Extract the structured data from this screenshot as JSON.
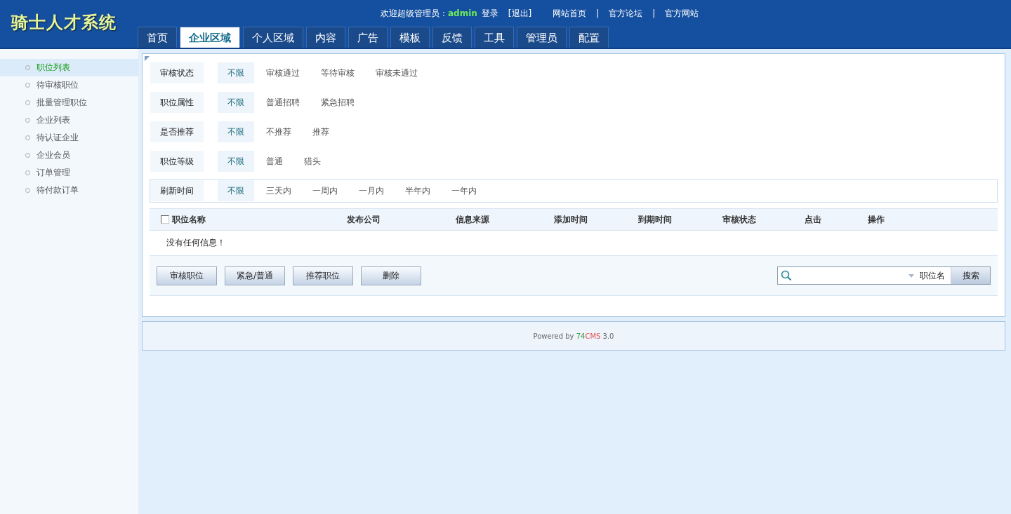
{
  "logo": "骑士人才系统",
  "top_bar": {
    "welcome": "欢迎超级管理员：",
    "user": "admin",
    "login": "登录",
    "logout": "[退出]",
    "links": [
      "网站首页",
      "官方论坛",
      "官方网站"
    ],
    "separator": "|"
  },
  "nav_tabs": [
    {
      "label": "首页",
      "selected": false
    },
    {
      "label": "企业区域",
      "selected": true
    },
    {
      "label": "个人区域",
      "selected": false
    },
    {
      "label": "内容",
      "selected": false
    },
    {
      "label": "广告",
      "selected": false
    },
    {
      "label": "模板",
      "selected": false
    },
    {
      "label": "反馈",
      "selected": false
    },
    {
      "label": "工具",
      "selected": false
    },
    {
      "label": "管理员",
      "selected": false
    },
    {
      "label": "配置",
      "selected": false
    }
  ],
  "sidebar": {
    "items": [
      {
        "label": "职位列表",
        "selected": true
      },
      {
        "label": "待审核职位",
        "selected": false
      },
      {
        "label": "批量管理职位",
        "selected": false
      },
      {
        "label": "企业列表",
        "selected": false
      },
      {
        "label": "待认证企业",
        "selected": false
      },
      {
        "label": "企业会员",
        "selected": false
      },
      {
        "label": "订单管理",
        "selected": false
      },
      {
        "label": "待付款订单",
        "selected": false
      }
    ]
  },
  "filters": [
    {
      "label": "审核状态",
      "highlighted": false,
      "options": [
        {
          "label": "不限",
          "selected": true
        },
        {
          "label": "审核通过",
          "selected": false
        },
        {
          "label": "等待审核",
          "selected": false
        },
        {
          "label": "审核未通过",
          "selected": false
        }
      ]
    },
    {
      "label": "职位属性",
      "highlighted": false,
      "options": [
        {
          "label": "不限",
          "selected": true
        },
        {
          "label": "普通招聘",
          "selected": false
        },
        {
          "label": "紧急招聘",
          "selected": false
        }
      ]
    },
    {
      "label": "是否推荐",
      "highlighted": false,
      "options": [
        {
          "label": "不限",
          "selected": true
        },
        {
          "label": "不推荐",
          "selected": false
        },
        {
          "label": "推荐",
          "selected": false
        }
      ]
    },
    {
      "label": "职位等级",
      "highlighted": false,
      "options": [
        {
          "label": "不限",
          "selected": true
        },
        {
          "label": "普通",
          "selected": false
        },
        {
          "label": "猎头",
          "selected": false
        }
      ]
    },
    {
      "label": "刷新时间",
      "highlighted": true,
      "options": [
        {
          "label": "不限",
          "selected": true
        },
        {
          "label": "三天内",
          "selected": false
        },
        {
          "label": "一周内",
          "selected": false
        },
        {
          "label": "一月内",
          "selected": false
        },
        {
          "label": "半年内",
          "selected": false
        },
        {
          "label": "一年内",
          "selected": false
        }
      ]
    }
  ],
  "table": {
    "select_all_checked": false,
    "columns": [
      "职位名称",
      "发布公司",
      "信息来源",
      "添加时间",
      "到期时间",
      "审核状态",
      "点击",
      "操作"
    ],
    "empty_message": "没有任何信息！"
  },
  "actions": [
    "审核职位",
    "紧急/普通",
    "推荐职位",
    "删除"
  ],
  "search": {
    "field_type": "职位名",
    "button": "搜索"
  },
  "footer": {
    "prefix": "Powered by",
    "brand_a": "74",
    "brand_b": "CMS",
    "version": "3.0"
  }
}
